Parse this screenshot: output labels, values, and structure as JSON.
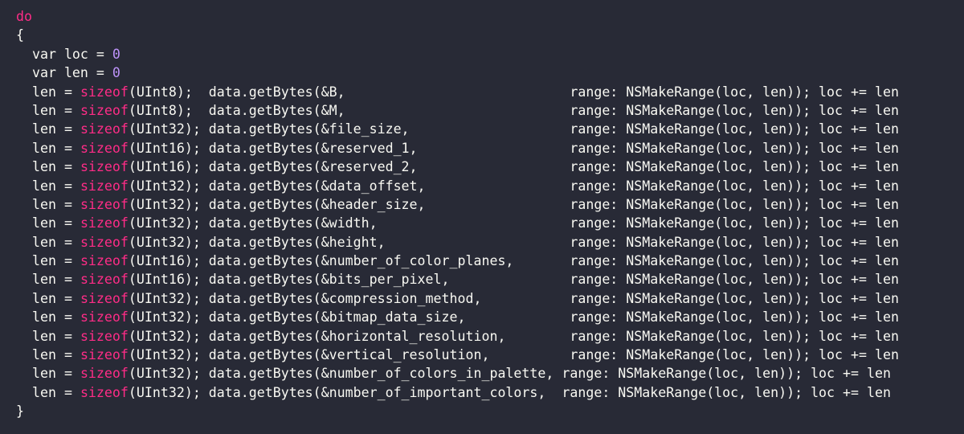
{
  "code": {
    "do_keyword": "do",
    "open_brace": "{",
    "close_brace": "}",
    "var_lines": [
      {
        "prefix": "  var loc = ",
        "value": "0"
      },
      {
        "prefix": "  var len = ",
        "value": "0"
      }
    ],
    "read_lines": [
      {
        "head": "  len = ",
        "keyword": "sizeof",
        "rest": "(UInt8);  data.getBytes(&B,                            range: NSMakeRange(loc, len)); loc += len"
      },
      {
        "head": "  len = ",
        "keyword": "sizeof",
        "rest": "(UInt8);  data.getBytes(&M,                            range: NSMakeRange(loc, len)); loc += len"
      },
      {
        "head": "  len = ",
        "keyword": "sizeof",
        "rest": "(UInt32); data.getBytes(&file_size,                    range: NSMakeRange(loc, len)); loc += len"
      },
      {
        "head": "  len = ",
        "keyword": "sizeof",
        "rest": "(UInt16); data.getBytes(&reserved_1,                   range: NSMakeRange(loc, len)); loc += len"
      },
      {
        "head": "  len = ",
        "keyword": "sizeof",
        "rest": "(UInt16); data.getBytes(&reserved_2,                   range: NSMakeRange(loc, len)); loc += len"
      },
      {
        "head": "  len = ",
        "keyword": "sizeof",
        "rest": "(UInt32); data.getBytes(&data_offset,                  range: NSMakeRange(loc, len)); loc += len"
      },
      {
        "head": "  len = ",
        "keyword": "sizeof",
        "rest": "(UInt32); data.getBytes(&header_size,                  range: NSMakeRange(loc, len)); loc += len"
      },
      {
        "head": "  len = ",
        "keyword": "sizeof",
        "rest": "(UInt32); data.getBytes(&width,                        range: NSMakeRange(loc, len)); loc += len"
      },
      {
        "head": "  len = ",
        "keyword": "sizeof",
        "rest": "(UInt32); data.getBytes(&height,                       range: NSMakeRange(loc, len)); loc += len"
      },
      {
        "head": "  len = ",
        "keyword": "sizeof",
        "rest": "(UInt16); data.getBytes(&number_of_color_planes,       range: NSMakeRange(loc, len)); loc += len"
      },
      {
        "head": "  len = ",
        "keyword": "sizeof",
        "rest": "(UInt16); data.getBytes(&bits_per_pixel,               range: NSMakeRange(loc, len)); loc += len"
      },
      {
        "head": "  len = ",
        "keyword": "sizeof",
        "rest": "(UInt32); data.getBytes(&compression_method,           range: NSMakeRange(loc, len)); loc += len"
      },
      {
        "head": "  len = ",
        "keyword": "sizeof",
        "rest": "(UInt32); data.getBytes(&bitmap_data_size,             range: NSMakeRange(loc, len)); loc += len"
      },
      {
        "head": "  len = ",
        "keyword": "sizeof",
        "rest": "(UInt32); data.getBytes(&horizontal_resolution,        range: NSMakeRange(loc, len)); loc += len"
      },
      {
        "head": "  len = ",
        "keyword": "sizeof",
        "rest": "(UInt32); data.getBytes(&vertical_resolution,          range: NSMakeRange(loc, len)); loc += len"
      },
      {
        "head": "  len = ",
        "keyword": "sizeof",
        "rest": "(UInt32); data.getBytes(&number_of_colors_in_palette, range: NSMakeRange(loc, len)); loc += len"
      },
      {
        "head": "  len = ",
        "keyword": "sizeof",
        "rest": "(UInt32); data.getBytes(&number_of_important_colors,  range: NSMakeRange(loc, len)); loc += len"
      }
    ]
  },
  "colors": {
    "background": "#282a36",
    "text": "#f8f8f2",
    "keyword": "#ff2c87",
    "number": "#bd93f9"
  }
}
